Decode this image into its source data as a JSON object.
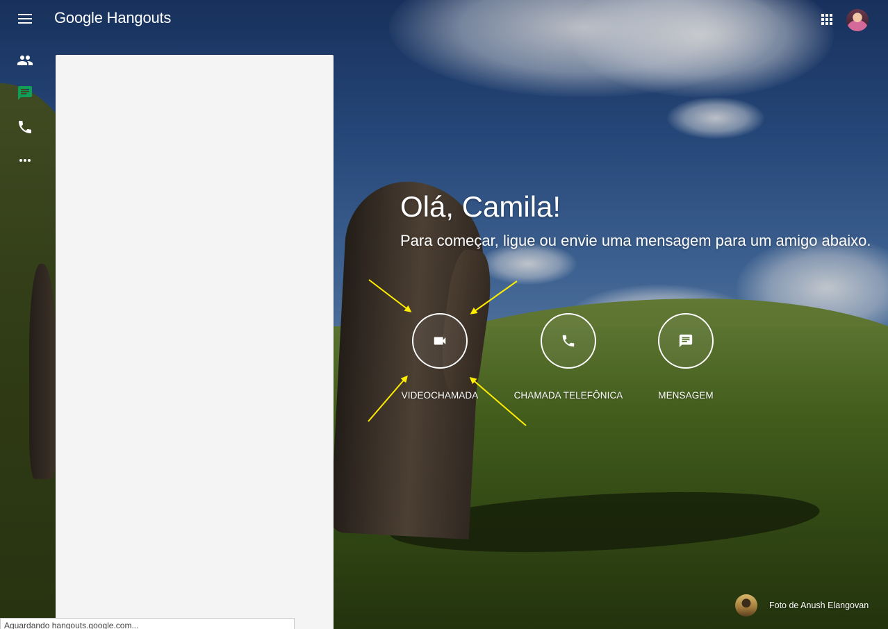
{
  "header": {
    "logo_text": "Google Hangouts",
    "menu_icon": "hamburger-menu-icon",
    "apps_icon": "apps-grid-icon",
    "account_avatar": "user-avatar"
  },
  "rail": {
    "items": [
      {
        "name": "contacts",
        "icon": "people-icon",
        "active": false
      },
      {
        "name": "conversations",
        "icon": "chat-bubble-icon",
        "active": true
      },
      {
        "name": "phone-calls",
        "icon": "phone-icon",
        "active": false
      },
      {
        "name": "more",
        "icon": "more-horiz-icon",
        "active": false
      }
    ],
    "active_color": "#0f9d58",
    "icon_color": "#ffffff"
  },
  "main": {
    "greeting": "Olá, Camila!",
    "subtitle": "Para começar, ligue ou envie uma mensagem para um amigo abaixo.",
    "actions": [
      {
        "label": "VIDEOCHAMADA",
        "icon": "videocam-icon"
      },
      {
        "label": "CHAMADA TELEFÔNICA",
        "icon": "phone-icon"
      },
      {
        "label": "MENSAGEM",
        "icon": "message-icon"
      }
    ],
    "annotation_arrow_color": "#ffee00"
  },
  "credit": {
    "text": "Foto de Anush Elangovan"
  },
  "status_bar": {
    "text": "Aguardando hangouts.google.com..."
  }
}
